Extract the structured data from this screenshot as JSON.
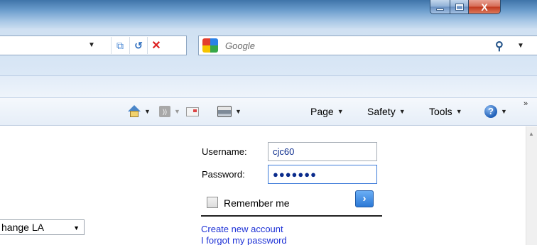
{
  "window": {
    "buttons": {
      "close_glyph": "X"
    }
  },
  "addressbar": {
    "dropdown_icon": "chevron-down-icon",
    "compat_icon": "compatibility-view-icon",
    "refresh_icon": "refresh-icon",
    "stop_icon": "stop-icon",
    "glyphs": {
      "dropdown": "▼",
      "compat": "⧉",
      "refresh": "↺",
      "stop": "✕"
    }
  },
  "search": {
    "placeholder": "Google",
    "search_glyph": "⚲",
    "dropdown_glyph": "▼"
  },
  "commandbar": {
    "caret": "▼",
    "more": "»",
    "page_label": "Page",
    "safety_label": "Safety",
    "tools_label": "Tools",
    "help_glyph": "?",
    "feed_glyph": "))"
  },
  "login": {
    "username_label": "Username:",
    "username_value": "cjc60",
    "password_label": "Password:",
    "password_value": "●●●●●●●",
    "remember_label": "Remember me",
    "go_glyph": "›",
    "create_account": "Create new account",
    "forgot_password": "I forgot my password"
  },
  "language_select": {
    "selected": "hange LA",
    "caret": "▼"
  },
  "scrollbar": {
    "up_glyph": "▲"
  },
  "colors": {
    "link": "#1d31d6",
    "accent": "#2b78d6",
    "title_bar": "#3f74a9",
    "close_button": "#c13a1f"
  }
}
